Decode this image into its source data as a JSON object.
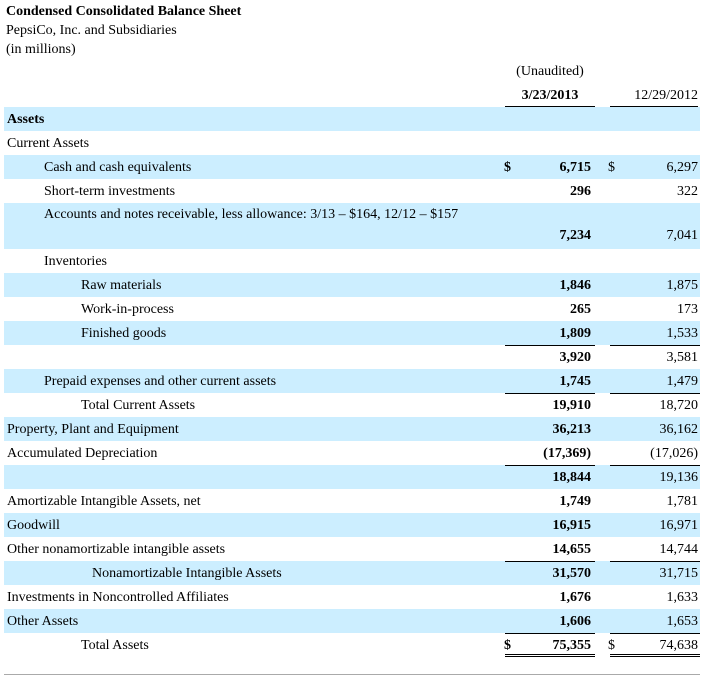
{
  "header": {
    "title": "Condensed Consolidated Balance Sheet",
    "company": "PepsiCo, Inc. and Subsidiaries",
    "units": "(in millions)"
  },
  "columns": {
    "unaudited": "(Unaudited)",
    "current": "3/23/2013",
    "prior": "12/29/2012"
  },
  "rows": [
    {
      "label": "Assets",
      "indent": 0,
      "bold": true,
      "shade": true
    },
    {
      "label": "Current Assets",
      "indent": 0
    },
    {
      "label": "Cash and cash equivalents",
      "indent": 1,
      "shade": true,
      "dollar_cur": "$",
      "cur": "6,715",
      "dollar_prior": "$",
      "prior": "6,297"
    },
    {
      "label": "Short-term investments",
      "indent": 1,
      "cur": "296",
      "prior": "322"
    },
    {
      "label": "Accounts and notes receivable, less allowance: 3/13 – $164, 12/12 – $157",
      "indent": 1,
      "shade": true,
      "tall": true,
      "cur": "7,234",
      "prior": "7,041"
    },
    {
      "label": "Inventories",
      "indent": 1
    },
    {
      "label": "Raw materials",
      "indent": 2,
      "shade": true,
      "cur": "1,846",
      "prior": "1,875"
    },
    {
      "label": "Work-in-process",
      "indent": 2,
      "cur": "265",
      "prior": "173"
    },
    {
      "label": "Finished goods",
      "indent": 2,
      "shade": true,
      "cur": "1,809",
      "prior": "1,533"
    },
    {
      "label": "",
      "indent": 0,
      "subtotal": true,
      "cur": "3,920",
      "prior": "3,581"
    },
    {
      "label": "Prepaid expenses and other current assets",
      "indent": 1,
      "shade": true,
      "cur": "1,745",
      "prior": "1,479"
    },
    {
      "label": "Total Current Assets",
      "indent": 2,
      "subtotal": true,
      "cur": "19,910",
      "prior": "18,720"
    },
    {
      "label": "Property, Plant and Equipment",
      "indent": 0,
      "shade": true,
      "cur": "36,213",
      "prior": "36,162"
    },
    {
      "label": "Accumulated Depreciation",
      "indent": 0,
      "cur": "(17,369)",
      "prior": "(17,026)"
    },
    {
      "label": "",
      "indent": 0,
      "shade": true,
      "subtotal": true,
      "cur": "18,844",
      "prior": "19,136"
    },
    {
      "label": "Amortizable Intangible Assets, net",
      "indent": 0,
      "cur": "1,749",
      "prior": "1,781"
    },
    {
      "label": "Goodwill",
      "indent": 0,
      "shade": true,
      "cur": "16,915",
      "prior": "16,971"
    },
    {
      "label": "Other nonamortizable intangible assets",
      "indent": 0,
      "cur": "14,655",
      "prior": "14,744"
    },
    {
      "label": "Nonamortizable Intangible Assets",
      "indent": 3,
      "shade": true,
      "subtotal": true,
      "cur": "31,570",
      "prior": "31,715"
    },
    {
      "label": "Investments in Noncontrolled Affiliates",
      "indent": 0,
      "cur": "1,676",
      "prior": "1,633"
    },
    {
      "label": "Other Assets",
      "indent": 0,
      "shade": true,
      "cur": "1,606",
      "prior": "1,653"
    },
    {
      "label": "Total Assets",
      "indent": 2,
      "total": true,
      "dollar_cur": "$",
      "cur": "75,355",
      "dollar_prior": "$",
      "prior": "74,638"
    }
  ]
}
